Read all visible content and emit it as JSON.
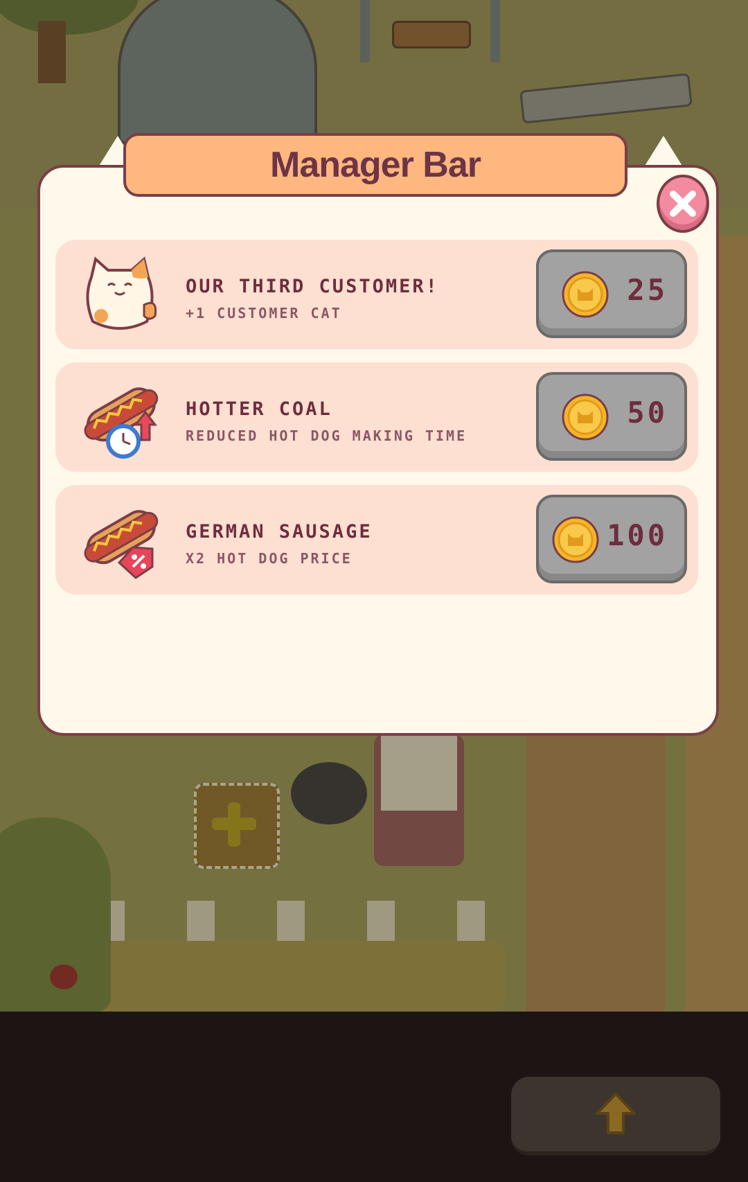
{
  "modal": {
    "title": "Manager Bar",
    "close_icon": "close-x-icon"
  },
  "upgrades": [
    {
      "icon": "cat-icon",
      "title": "Our third customer!",
      "description": "+1 customer cat",
      "price": "25",
      "currency_icon": "cat-coin-icon"
    },
    {
      "icon": "hotdog-timer-icon",
      "title": "Hotter coal",
      "description": "Reduced hot dog making time",
      "price": "50",
      "currency_icon": "cat-coin-icon"
    },
    {
      "icon": "hotdog-discount-icon",
      "title": "German sausage",
      "description": "x2 hot dog price",
      "price": "100",
      "currency_icon": "cat-coin-icon"
    }
  ],
  "bottom_bar": {
    "up_icon": "up-arrow-icon"
  },
  "colors": {
    "accent": "#fdb77f",
    "border": "#7b3e47",
    "row_bg": "#fde0d1",
    "close": "#f28aa0",
    "coin": "#f5b52a"
  }
}
